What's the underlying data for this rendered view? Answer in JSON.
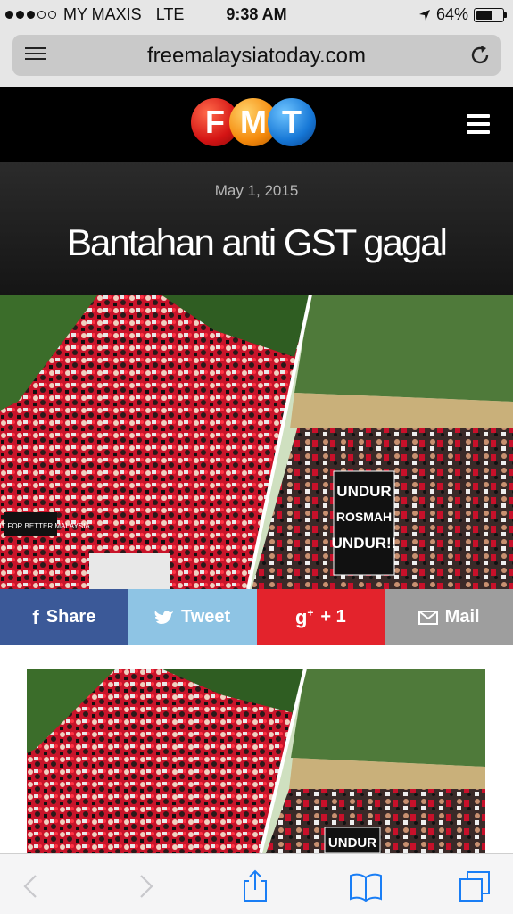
{
  "status_bar": {
    "carrier": "MY MAXIS",
    "network": "LTE",
    "time": "9:38 AM",
    "battery_percent": "64%",
    "battery_level": 0.64,
    "signal_bars_filled": 3,
    "signal_bars_total": 5
  },
  "address_bar": {
    "url": "freemalaysiatoday.com"
  },
  "site_header": {
    "logo_letters": [
      "F",
      "M",
      "T"
    ]
  },
  "article": {
    "date": "May 1, 2015",
    "title": "Bantahan anti GST gagal"
  },
  "hero_image": {
    "protest_signs": [
      "UNDUR",
      "ROSMAH",
      "UNDUR!!"
    ],
    "banner_text": "WE FIGHT FOR BETTER MALAYSIA"
  },
  "share_bar": {
    "facebook": "Share",
    "twitter": "Tweet",
    "googleplus": "+ 1",
    "mail": "Mail",
    "colors": {
      "facebook": "#3b5998",
      "twitter": "#8ec4e4",
      "googleplus": "#e3232c",
      "mail": "#9e9e9e"
    }
  },
  "article_image": {
    "protest_sign": "UNDUR"
  },
  "toolbar": {
    "icons": [
      "back-icon",
      "forward-icon",
      "share-icon",
      "bookmarks-icon",
      "tabs-icon"
    ],
    "accent": "#1a7ef5"
  }
}
